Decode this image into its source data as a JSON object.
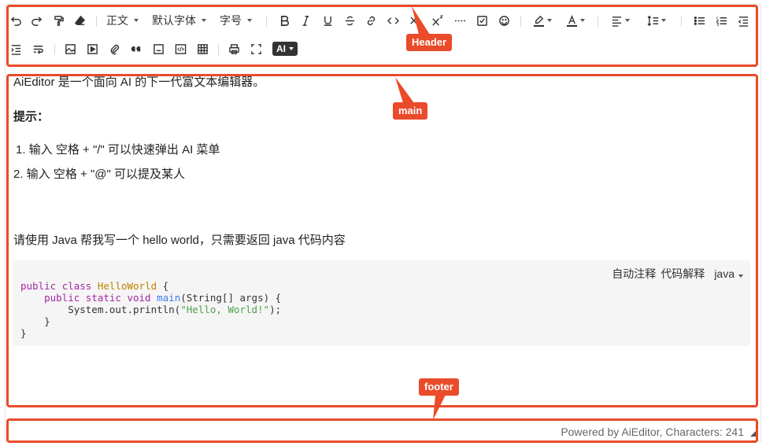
{
  "annotations": {
    "header": "Header",
    "main": "main",
    "footer": "footer"
  },
  "toolbar": {
    "paragraph_select": "正文",
    "font_select": "默认字体",
    "size_select": "字号",
    "ai_label": "AI"
  },
  "content": {
    "intro": "AiEditor 是一个面向 AI 的下一代富文本编辑器。",
    "tip_title": "提示：",
    "list": [
      "1. 输入 空格 + \"/\" 可以快速弹出 AI 菜单",
      "2. 输入 空格 + \"@\" 可以提及某人"
    ],
    "ask": "请使用 Java 帮我写一个 hello world，只需要返回 java 代码内容"
  },
  "code_block": {
    "tool_comment": "自动注释",
    "tool_explain": "代码解释",
    "language": "java"
  },
  "footer": {
    "status": "Powered by AiEditor, Characters: 241"
  }
}
